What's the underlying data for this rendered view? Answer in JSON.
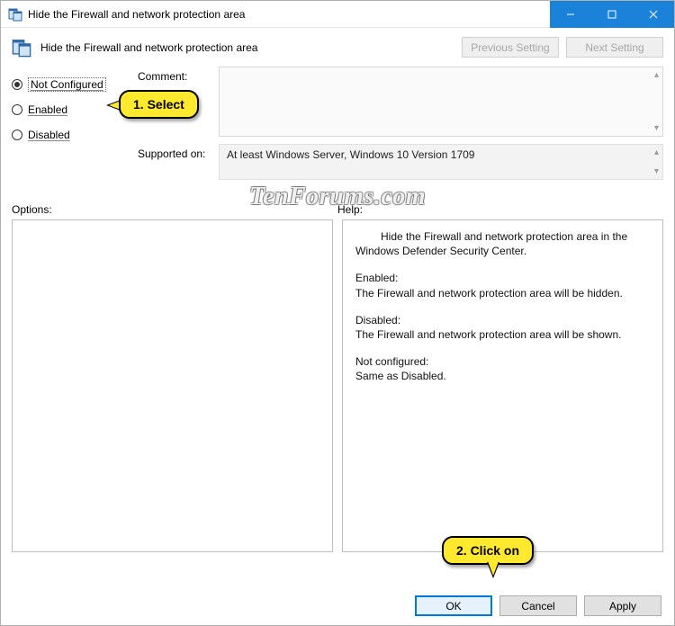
{
  "titlebar": {
    "title": "Hide the Firewall and network protection area"
  },
  "header": {
    "title": "Hide the Firewall and network protection area",
    "prev_label": "Previous Setting",
    "next_label": "Next Setting"
  },
  "radios": {
    "not_configured": "Not Configured",
    "enabled": "Enabled",
    "disabled": "Disabled",
    "selected": "not_configured"
  },
  "fields": {
    "comment_label": "Comment:",
    "supported_label": "Supported on:",
    "supported_value": "At least Windows Server, Windows 10 Version 1709"
  },
  "sections": {
    "options_label": "Options:",
    "help_label": "Help:"
  },
  "help": {
    "intro": "Hide the Firewall and network protection area in the Windows Defender Security Center.",
    "enabled_h": "Enabled:",
    "enabled_t": "The Firewall and network protection area will be hidden.",
    "disabled_h": "Disabled:",
    "disabled_t": "The Firewall and network protection area will be shown.",
    "notconf_h": "Not configured:",
    "notconf_t": "Same as Disabled."
  },
  "buttons": {
    "ok": "OK",
    "cancel": "Cancel",
    "apply": "Apply"
  },
  "callouts": {
    "c1": "1. Select",
    "c2": "2. Click on"
  },
  "watermark": "TenForums.com"
}
